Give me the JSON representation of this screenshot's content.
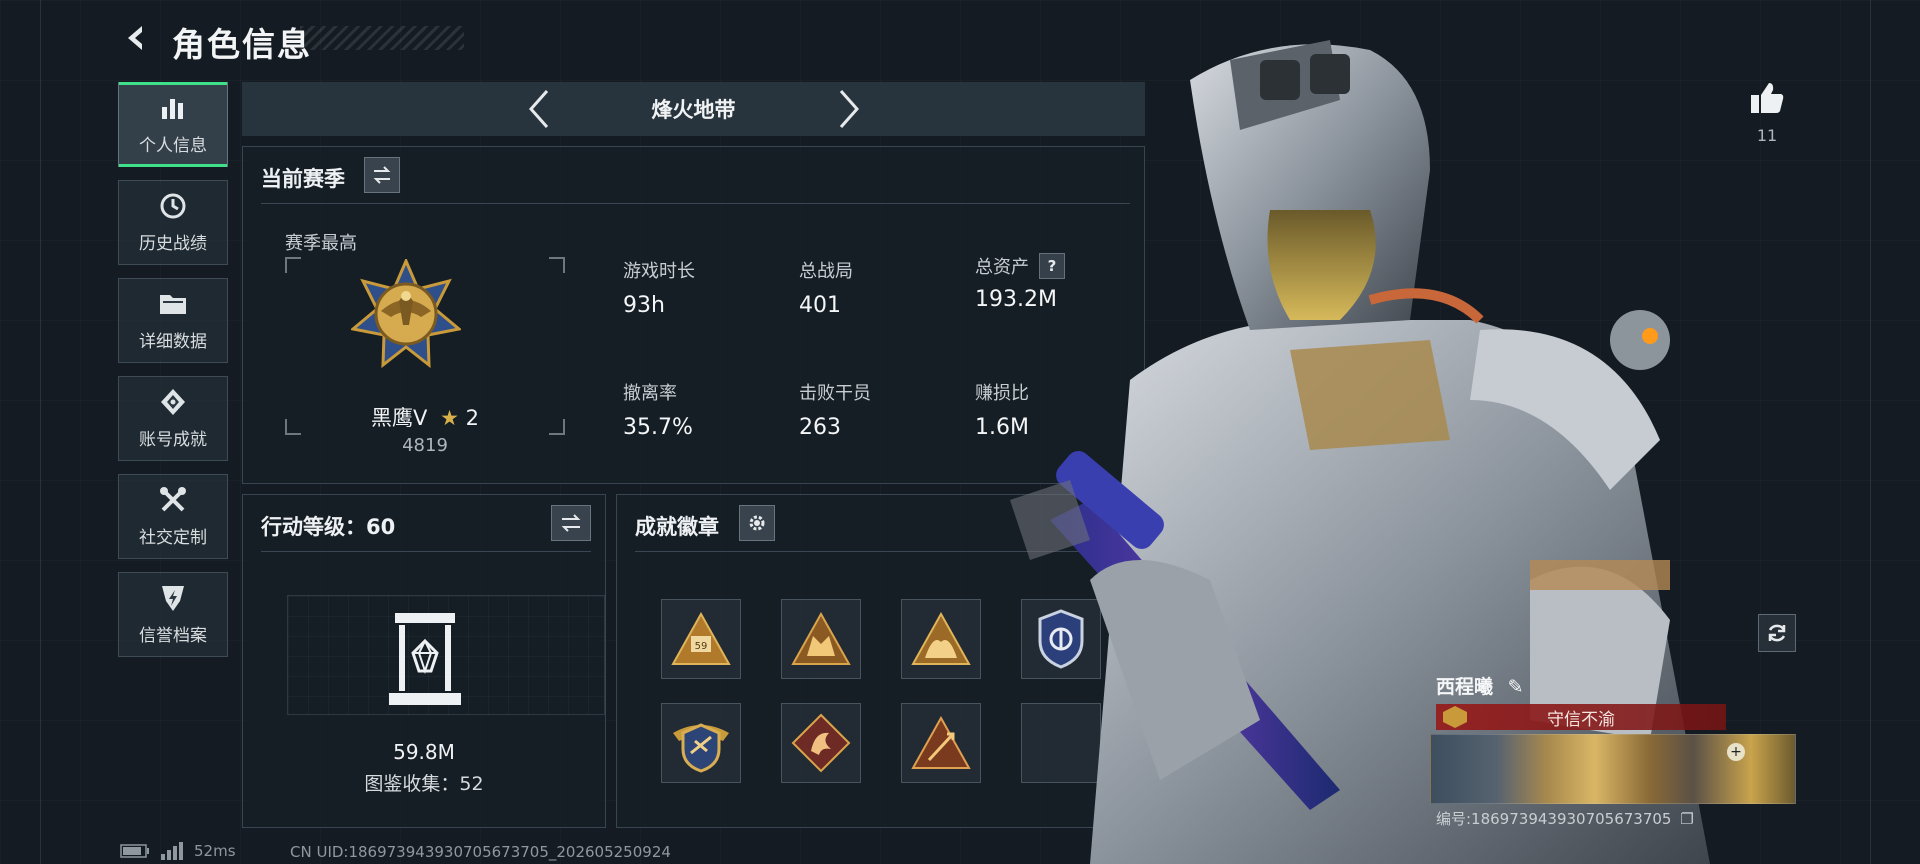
{
  "header": {
    "title": "角色信息"
  },
  "sidebar": {
    "items": [
      {
        "label": "个人信息",
        "icon": "bar-chart-icon",
        "active": true
      },
      {
        "label": "历史战绩",
        "icon": "history-clock-icon",
        "active": false
      },
      {
        "label": "详细数据",
        "icon": "folder-icon",
        "active": false
      },
      {
        "label": "账号成就",
        "icon": "achievement-icon",
        "active": false
      },
      {
        "label": "社交定制",
        "icon": "wrench-screwdriver-icon",
        "active": false
      },
      {
        "label": "信誉档案",
        "icon": "credit-shield-icon",
        "active": false
      }
    ]
  },
  "mode": {
    "title": "烽火地带"
  },
  "season": {
    "title": "当前赛季",
    "subtitle": "赛季最高",
    "rank_name": "黑鹰V",
    "rank_stars": "2",
    "rank_score": "4819",
    "stats": [
      {
        "label": "游戏时长",
        "value": "93h"
      },
      {
        "label": "总战局",
        "value": "401"
      },
      {
        "label": "总资产",
        "value": "193.2M",
        "help": "?"
      },
      {
        "label": "撤离率",
        "value": "35.7%"
      },
      {
        "label": "击败干员",
        "value": "263"
      },
      {
        "label": "赚损比",
        "value": "1.6M"
      }
    ]
  },
  "action_level": {
    "title": "行动等级：60",
    "collection_value": "59.8M",
    "collection_count": "图鉴收集：52"
  },
  "badges": {
    "title": "成就徽章",
    "slots": [
      {
        "icon": "triangle-59-badge-icon",
        "filled": true
      },
      {
        "icon": "triangle-wolf-badge-icon",
        "filled": true
      },
      {
        "icon": "triangle-beast-badge-icon",
        "filled": true
      },
      {
        "icon": "police-shield-badge-icon",
        "filled": true
      },
      {
        "icon": "winged-shield-badge-icon",
        "filled": true
      },
      {
        "icon": "diamond-dragon-badge-icon",
        "filled": true
      },
      {
        "icon": "triangle-sword-badge-icon",
        "filled": true
      },
      {
        "icon": "",
        "filled": false
      }
    ]
  },
  "profile": {
    "likes": "11",
    "player_name": "西程曦",
    "player_title": "守信不渝",
    "player_id": "编号:186973943930705673705"
  },
  "footer": {
    "ping": "52ms",
    "uid": "CN UID:186973943930705673705_202605250924"
  },
  "colors": {
    "accent_green": "#3fe08a",
    "gold": "#c99a3a",
    "title_red": "#961e1e"
  }
}
